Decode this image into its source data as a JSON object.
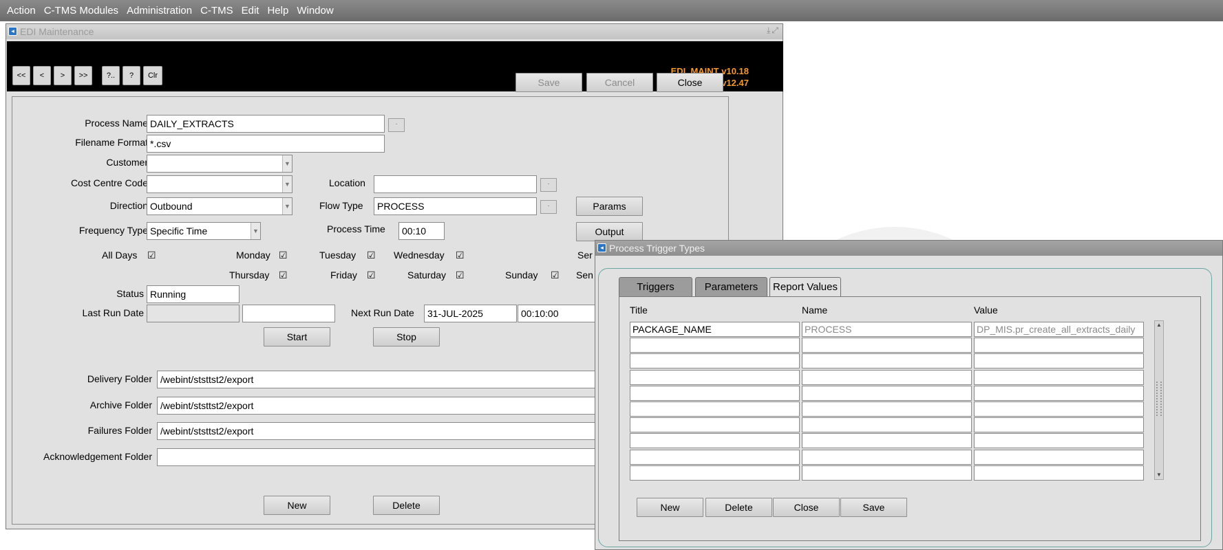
{
  "menubar": {
    "items": [
      "Action",
      "C-TMS Modules",
      "Administration",
      "C-TMS",
      "Edit",
      "Help",
      "Window"
    ]
  },
  "edi": {
    "title": "EDI Maintenance",
    "nav": [
      "<<",
      "<",
      ">",
      ">>",
      "?..",
      "?",
      "Clr"
    ],
    "version_line1": "EDI_MAINT v10.18",
    "version_line2": "C-TMS v12.47",
    "actions": {
      "save": "Save",
      "cancel": "Cancel",
      "close": "Close"
    },
    "labels": {
      "process_name": "Process Name",
      "filename_format": "Filename Format",
      "customer": "Customer",
      "cost_centre": "Cost Centre Code",
      "location": "Location",
      "direction": "Direction",
      "flow_type": "Flow Type",
      "frequency_type": "Frequency Type",
      "process_time": "Process Time",
      "all_days": "All Days",
      "monday": "Monday",
      "tuesday": "Tuesday",
      "wednesday": "Wednesday",
      "thursday": "Thursday",
      "friday": "Friday",
      "saturday": "Saturday",
      "sunday": "Sunday",
      "sen1": "Ser",
      "sen2": "Sen",
      "status": "Status",
      "last_run_date": "Last Run Date",
      "next_run_date": "Next Run Date",
      "delivery_folder": "Delivery Folder",
      "archive_folder": "Archive Folder",
      "failures_folder": "Failures Folder",
      "ack_folder": "Acknowledgement Folder"
    },
    "values": {
      "process_name": "DAILY_EXTRACTS",
      "filename_format": "*.csv",
      "customer": "",
      "cost_centre": "",
      "location": "",
      "direction": "Outbound",
      "flow_type": "PROCESS",
      "frequency_type": "Specific Time",
      "process_time": "00:10",
      "status": "Running",
      "last_run_date": "",
      "last_run_time": "",
      "next_run_date": "31-JUL-2025",
      "next_run_time": "00:10:00",
      "delivery_folder": "/webint/ststtst2/export",
      "archive_folder": "/webint/ststtst2/export",
      "failures_folder": "/webint/ststtst2/export",
      "ack_folder": ""
    },
    "buttons": {
      "params": "Params",
      "output": "Output",
      "start": "Start",
      "stop": "Stop",
      "new": "New",
      "delete": "Delete"
    }
  },
  "trigger": {
    "title": "Process Trigger Types",
    "tabs": [
      "Triggers",
      "Parameters",
      "Report Values"
    ],
    "columns": [
      "Title",
      "Name",
      "Value"
    ],
    "rows": [
      [
        "PACKAGE_NAME",
        "PROCESS",
        "DP_MIS.pr_create_all_extracts_daily"
      ]
    ],
    "buttons": {
      "new": "New",
      "delete": "Delete",
      "close": "Close",
      "save": "Save"
    }
  }
}
